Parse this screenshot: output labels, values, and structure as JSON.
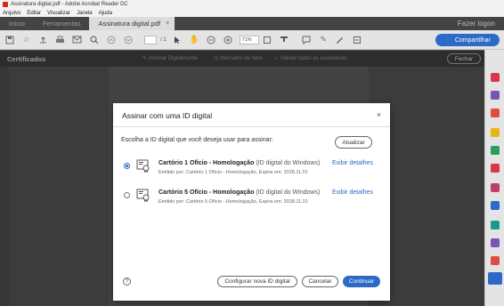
{
  "window": {
    "title": "Assinatura digital.pdf - Adobe Acrobat Reader DC"
  },
  "menu": {
    "items": [
      "Arquivo",
      "Editar",
      "Visualizar",
      "Janela",
      "Ajuda"
    ]
  },
  "tabs": {
    "items": [
      "Início",
      "Ferramentas",
      "Assinatura digital.pdf"
    ],
    "login": "Fazer logon"
  },
  "toolbar": {
    "page_total": "/ 1",
    "zoom": "71%",
    "share_label": "Compartilhar"
  },
  "certbar": {
    "title": "Certificados",
    "actions": [
      "Assinar Digitalmente",
      "Marcador de hora",
      "Validar todas as assinaturas"
    ],
    "close_label": "Fechar"
  },
  "dialog": {
    "title": "Assinar com uma ID digital",
    "instruction": "Escolha a ID digital que você deseja usar para assinar:",
    "refresh_label": "Atualizar",
    "ids": [
      {
        "name": "Cartório 1 Ofício - Homologação",
        "type": "(ID digital do Windows)",
        "issued": "Emitido por: Cartório 1 Ofício - Homologação, Expira em: 2028.11.01",
        "details_label": "Exibir detalhes",
        "selected": true
      },
      {
        "name": "Cartório 5 Ofício - Homologação",
        "type": "(ID digital do Windows)",
        "issued": "Emitido por: Cartório 5 Ofício - Homologação, Expira em: 2028.11.01",
        "details_label": "Exibir detalhes",
        "selected": false
      }
    ],
    "configure_label": "Configurar nova ID digital",
    "cancel_label": "Cancelar",
    "continue_label": "Continuar",
    "help_glyph": "?",
    "close_glyph": "×"
  },
  "colors": {
    "accent": "#2d6ac6",
    "tabbar": "#444444",
    "certbar": "#3c3c3c"
  }
}
